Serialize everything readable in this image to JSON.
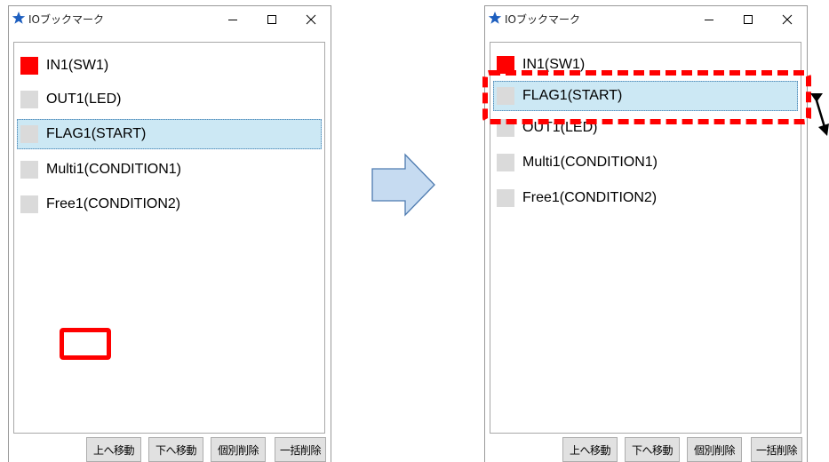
{
  "left_window": {
    "title": "IOブックマーク",
    "items": [
      {
        "label": "IN1(SW1)",
        "state_color": "#ff0000",
        "selected": false
      },
      {
        "label": "OUT1(LED)",
        "state_color": "#dadada",
        "selected": false
      },
      {
        "label": "FLAG1(START)",
        "state_color": "#dadada",
        "selected": true
      },
      {
        "label": "Multi1(CONDITION1)",
        "state_color": "#dadada",
        "selected": false
      },
      {
        "label": "Free1(CONDITION2)",
        "state_color": "#dadada",
        "selected": false
      }
    ],
    "buttons": {
      "move_up": "上へ移動",
      "move_down": "下へ移動",
      "delete_one": "個別削除",
      "delete_all": "一括削除"
    }
  },
  "right_window": {
    "title": "IOブックマーク",
    "items": [
      {
        "label": "IN1(SW1)",
        "state_color": "#ff0000",
        "selected": false
      },
      {
        "label": "FLAG1(START)",
        "state_color": "#dadada",
        "selected": true
      },
      {
        "label": "OUT1(LED)",
        "state_color": "#dadada",
        "selected": false
      },
      {
        "label": "Multi1(CONDITION1)",
        "state_color": "#dadada",
        "selected": false
      },
      {
        "label": "Free1(CONDITION2)",
        "state_color": "#dadada",
        "selected": false
      }
    ],
    "buttons": {
      "move_up": "上へ移動",
      "move_down": "下へ移動",
      "delete_one": "個別削除",
      "delete_all": "一括削除"
    }
  },
  "icons": {
    "app": "star-icon",
    "minimize": "minimize-icon",
    "maximize": "maximize-icon",
    "close": "close-icon",
    "transition": "right-arrow-icon",
    "swap": "swap-arrows-icon"
  },
  "colors": {
    "accent_red": "#ff0000",
    "selection_bg": "#cce8f4",
    "star": "#1e5fbf",
    "arrow_fill": "#c6dbf1",
    "arrow_stroke": "#4e7bb0"
  }
}
